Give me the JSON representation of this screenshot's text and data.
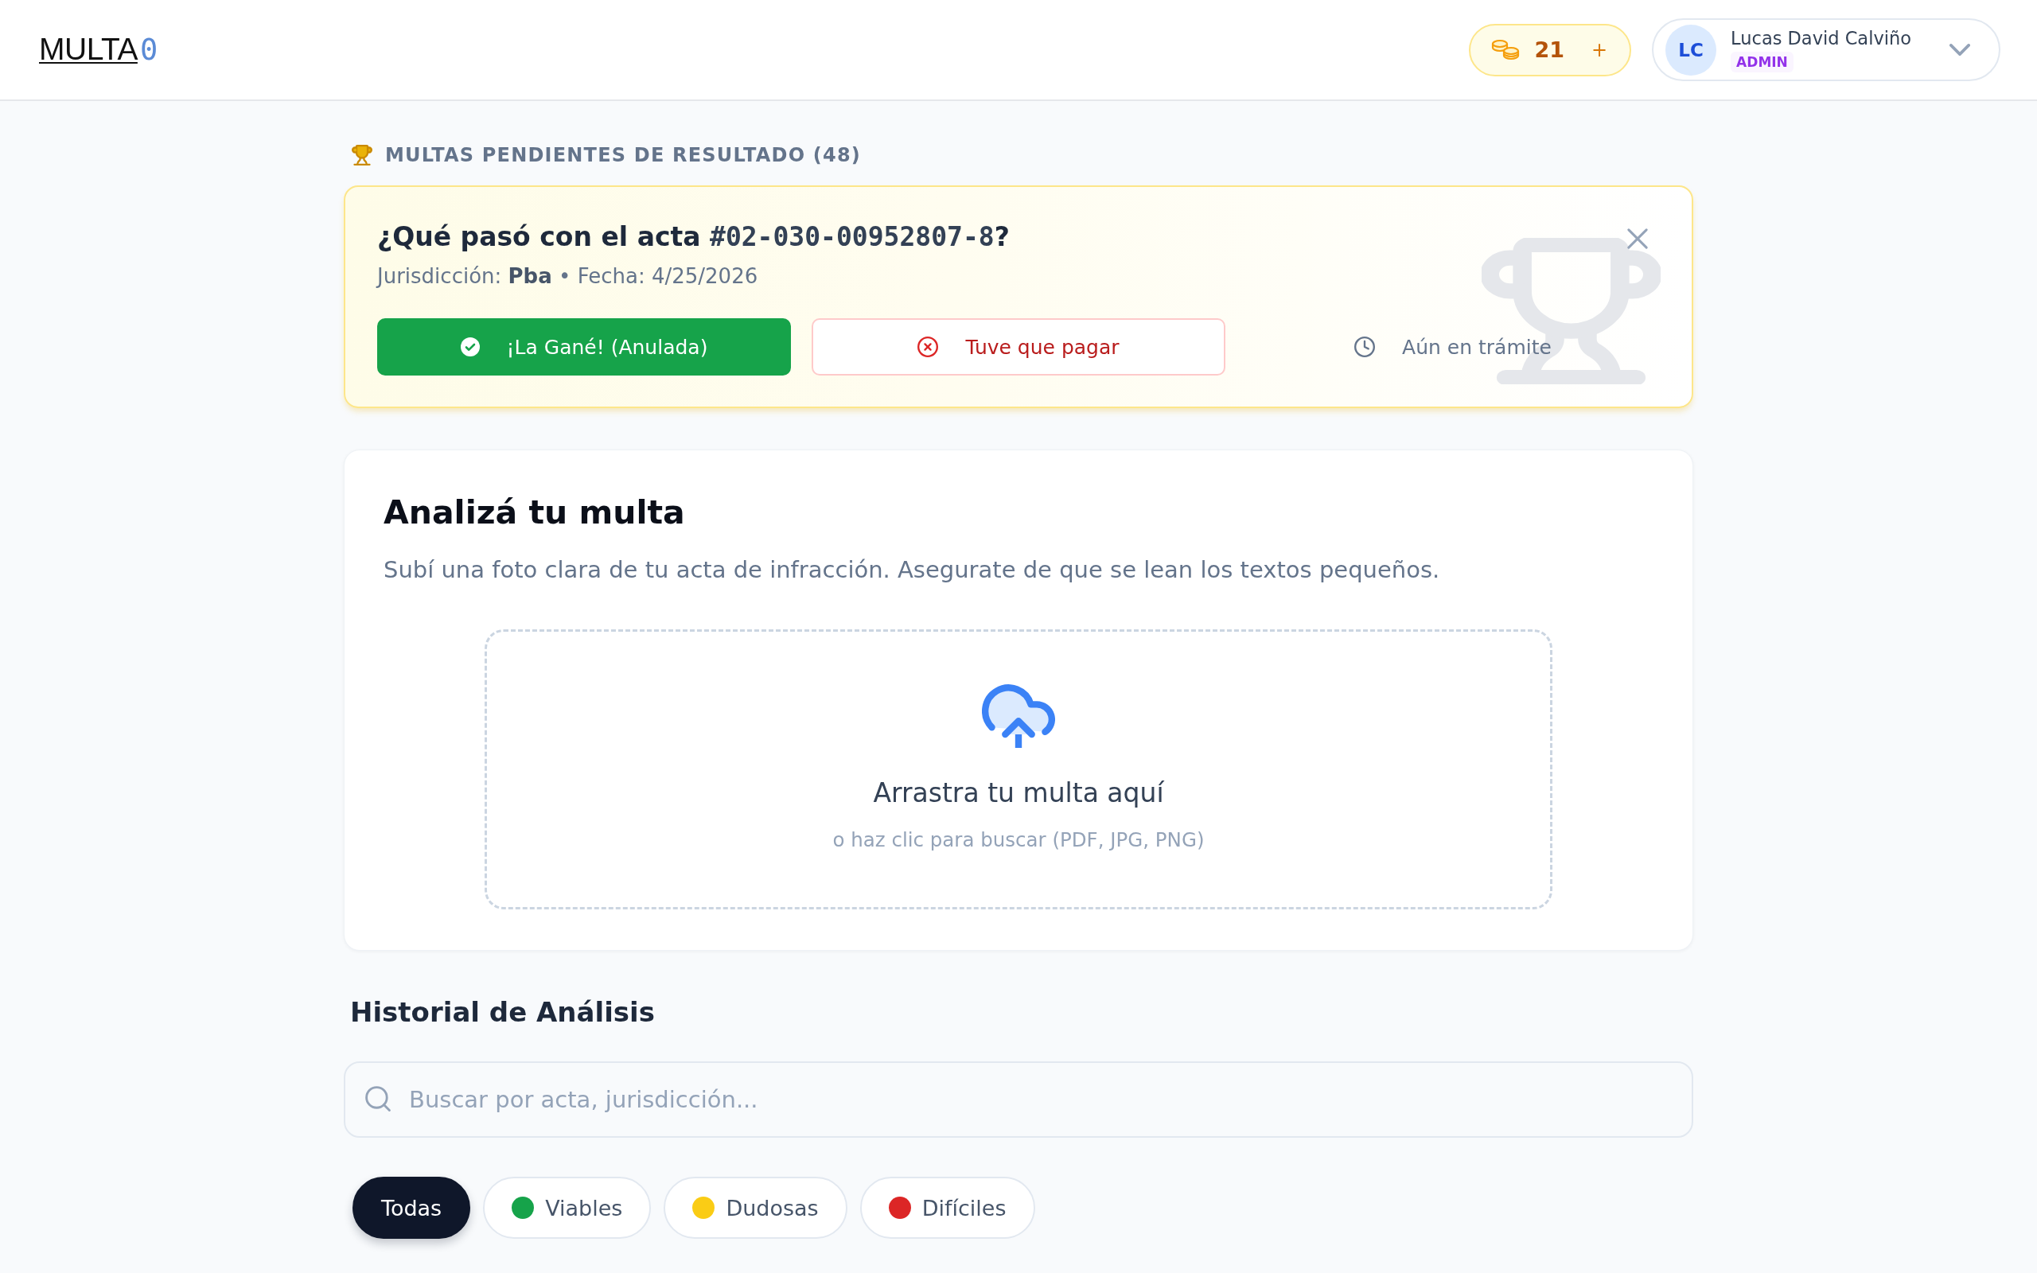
{
  "header": {
    "logo": {
      "text": "MULTA",
      "accent": "0"
    },
    "credits": {
      "count": "21",
      "add": "+"
    },
    "user": {
      "initials": "LC",
      "name": "Lucas David Calviño",
      "role": "ADMIN"
    }
  },
  "pending": {
    "heading": "MULTAS PENDIENTES DE RESULTADO (48)",
    "question": {
      "lead": "¿Qué pasó con el acta ",
      "code": "#02-030-00952807-8",
      "trail": "?"
    },
    "details": "Jurisdicción: **Pba** • Fecha: 4/25/2026",
    "actions": [
      {
        "kind": "won",
        "label": "¡La Gané! (Anulada)"
      },
      {
        "kind": "paid",
        "label": "Tuve que pagar"
      },
      {
        "kind": "pending",
        "label": "Aún en trámite"
      }
    ]
  },
  "analyze": {
    "title": "Analizá tu multa",
    "description": "Subí una foto clara de tu acta de infracción. Asegurate de que se lean los textos pequeños.",
    "dropzone": {
      "title": "Arrastra tu multa aquí",
      "hint": "o haz clic para buscar (PDF, JPG, PNG)"
    }
  },
  "history": {
    "title": "Historial de Análisis",
    "search": {
      "placeholder": "Buscar por acta, jurisdicción..."
    },
    "filters": [
      {
        "label": "Todas",
        "selected": true
      },
      {
        "label": "Viables",
        "selected": false,
        "color": "#16a34a"
      },
      {
        "label": "Dudosas",
        "selected": false,
        "color": "#facc15"
      },
      {
        "label": "Difíciles",
        "selected": false,
        "color": "#dc2626"
      }
    ]
  }
}
